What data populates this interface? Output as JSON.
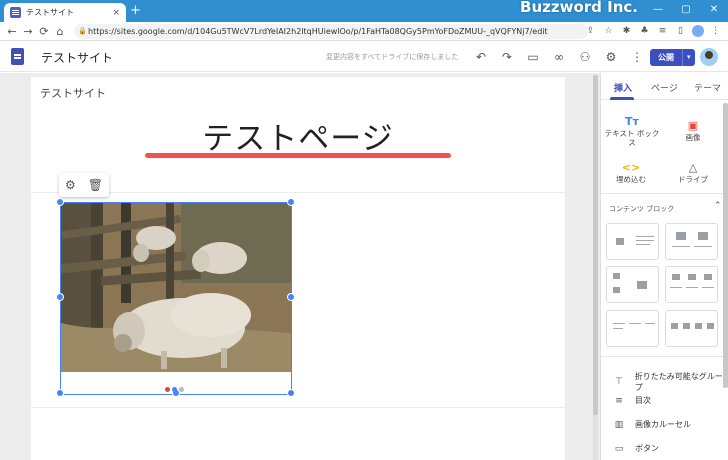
{
  "browser": {
    "tab_title": "テストサイト",
    "tab_close": "×",
    "new_tab": "+",
    "url": "https://sites.google.com/d/104Gu5TWcV7LrdYeIAI2h2ltqHUiewlOo/p/1FaHTa08QGy5PmYoFDoZMUU-_qVQFYNj7/edit",
    "brand": "Buzzword Inc.",
    "win_min": "—",
    "win_max": "▢",
    "win_close": "✕",
    "nav_back": "←",
    "nav_forward": "→",
    "nav_reload": "⟳",
    "nav_home": "⌂"
  },
  "header": {
    "site_name": "テストサイト",
    "save_status": "変更内容をすべてドライブに保存しました",
    "publish_label": "公開",
    "publish_dropdown": "▾",
    "icons": [
      "undo-icon",
      "redo-icon",
      "preview-icon",
      "link-icon",
      "share-icon",
      "settings-icon",
      "more-icon"
    ]
  },
  "canvas": {
    "site_name": "テストサイト",
    "page_title": "テストページ",
    "accent_color": "#f35350",
    "image_alt": "Sheep in a wooden pen"
  },
  "panel": {
    "tabs": [
      "挿入",
      "ページ",
      "テーマ"
    ],
    "insert_items": [
      {
        "icon": "Tт",
        "label": "テキスト ボックス"
      },
      {
        "icon": "▣",
        "label": "画像"
      },
      {
        "icon": "<>",
        "label": "埋め込む"
      },
      {
        "icon": "△",
        "label": "ドライブ"
      }
    ],
    "content_blocks_title": "コンテンツ ブロック",
    "list_items": [
      {
        "icon": "⊤",
        "label": "折りたたみ可能なグループ"
      },
      {
        "icon": "≡",
        "label": "目次"
      },
      {
        "icon": "▥",
        "label": "画像カルーセル"
      },
      {
        "icon": "▭",
        "label": "ボタン"
      }
    ]
  }
}
